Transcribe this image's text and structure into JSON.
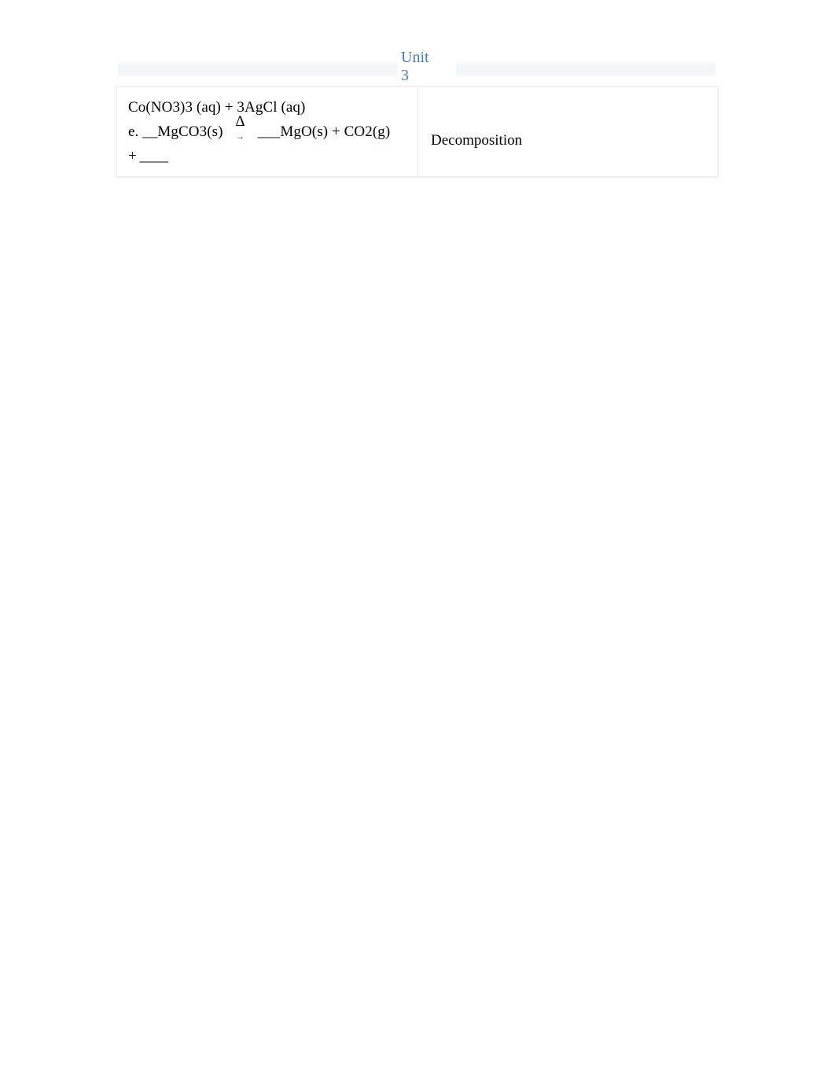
{
  "header": {
    "title": "Unit 3",
    "band_color": "#f2f6f7",
    "title_color": "#4a7ebb"
  },
  "table": {
    "rows": [
      {
        "equation": {
          "line1": "Co(NO3)3 (aq) + 3AgCl (aq)",
          "line2_prefix": "e. __MgCO3(s)",
          "condition_symbol": "Δ",
          "arrow_symbol": "→",
          "line2_suffix": "___MgO(s) + CO2(g)",
          "line3": "+ ____"
        },
        "reaction_type": "Decomposition"
      }
    ]
  }
}
